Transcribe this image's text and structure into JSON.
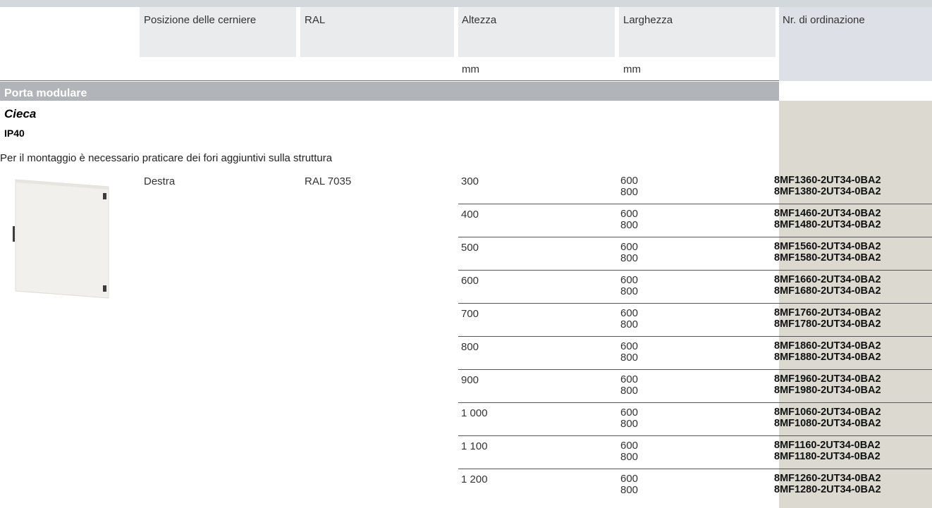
{
  "header": {
    "col_hinge": "Posizione delle cerniere",
    "col_ral": "RAL",
    "col_height": "Altezza",
    "col_width": "Larghezza",
    "col_order": "Nr. di ordinazione",
    "unit_height": "mm",
    "unit_width": "mm"
  },
  "section": {
    "title": "Porta modulare",
    "variant": "Cieca",
    "protection": "IP40",
    "note": "Per il montaggio è necessario praticare dei fori aggiuntivi sulla struttura"
  },
  "product": {
    "hinge": "Destra",
    "ral": "RAL 7035",
    "image_icon": "modular-door-image"
  },
  "rows": [
    {
      "height": "300",
      "width_a": "600",
      "width_b": "800",
      "order_a": "8MF1360-2UT34-0BA2",
      "order_b": "8MF1380-2UT34-0BA2"
    },
    {
      "height": "400",
      "width_a": "600",
      "width_b": "800",
      "order_a": "8MF1460-2UT34-0BA2",
      "order_b": "8MF1480-2UT34-0BA2"
    },
    {
      "height": "500",
      "width_a": "600",
      "width_b": "800",
      "order_a": "8MF1560-2UT34-0BA2",
      "order_b": "8MF1580-2UT34-0BA2"
    },
    {
      "height": "600",
      "width_a": "600",
      "width_b": "800",
      "order_a": "8MF1660-2UT34-0BA2",
      "order_b": "8MF1680-2UT34-0BA2"
    },
    {
      "height": "700",
      "width_a": "600",
      "width_b": "800",
      "order_a": "8MF1760-2UT34-0BA2",
      "order_b": "8MF1780-2UT34-0BA2"
    },
    {
      "height": "800",
      "width_a": "600",
      "width_b": "800",
      "order_a": "8MF1860-2UT34-0BA2",
      "order_b": "8MF1880-2UT34-0BA2"
    },
    {
      "height": "900",
      "width_a": "600",
      "width_b": "800",
      "order_a": "8MF1960-2UT34-0BA2",
      "order_b": "8MF1980-2UT34-0BA2"
    },
    {
      "height": "1 000",
      "width_a": "600",
      "width_b": "800",
      "order_a": "8MF1060-2UT34-0BA2",
      "order_b": "8MF1080-2UT34-0BA2"
    },
    {
      "height": "1 100",
      "width_a": "600",
      "width_b": "800",
      "order_a": "8MF1160-2UT34-0BA2",
      "order_b": "8MF1180-2UT34-0BA2"
    },
    {
      "height": "1 200",
      "width_a": "600",
      "width_b": "800",
      "order_a": "8MF1260-2UT34-0BA2",
      "order_b": "8MF1280-2UT34-0BA2"
    }
  ],
  "colors": {
    "header_bg": "#e9ebed",
    "order_header_bg": "#dde1e7",
    "section_bar": "#b1b4b8",
    "order_col_bg": "#dbd9d0"
  }
}
